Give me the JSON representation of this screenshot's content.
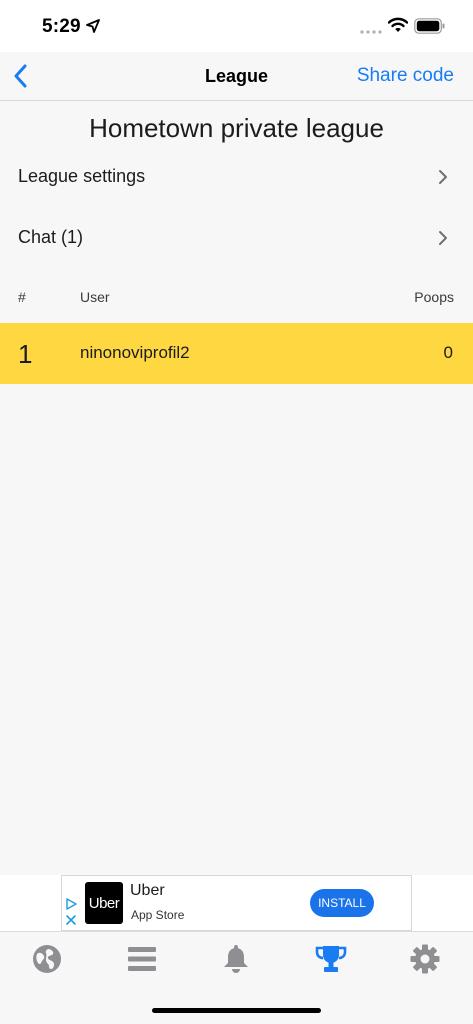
{
  "status_bar": {
    "time": "5:29"
  },
  "nav": {
    "title": "League",
    "share_label": "Share code"
  },
  "league": {
    "name": "Hometown private league"
  },
  "menu": [
    {
      "label": "League settings"
    },
    {
      "label": "Chat (1)"
    }
  ],
  "table": {
    "headers": {
      "rank": "#",
      "user": "User",
      "poops": "Poops"
    },
    "rows": [
      {
        "rank": "1",
        "user": "ninonoviprofil2",
        "poops": "0"
      }
    ]
  },
  "ad": {
    "logo_text": "Uber",
    "title": "Uber",
    "subtitle": "App Store",
    "install_label": "INSTALL"
  },
  "tabs": [
    {
      "icon": "globe-icon",
      "active": false
    },
    {
      "icon": "list-icon",
      "active": false
    },
    {
      "icon": "bell-icon",
      "active": false
    },
    {
      "icon": "trophy-icon",
      "active": true
    },
    {
      "icon": "gear-icon",
      "active": false
    }
  ],
  "colors": {
    "accent": "#1a7cf2",
    "highlight_row": "#fed741",
    "tab_inactive": "#8e8e93"
  }
}
